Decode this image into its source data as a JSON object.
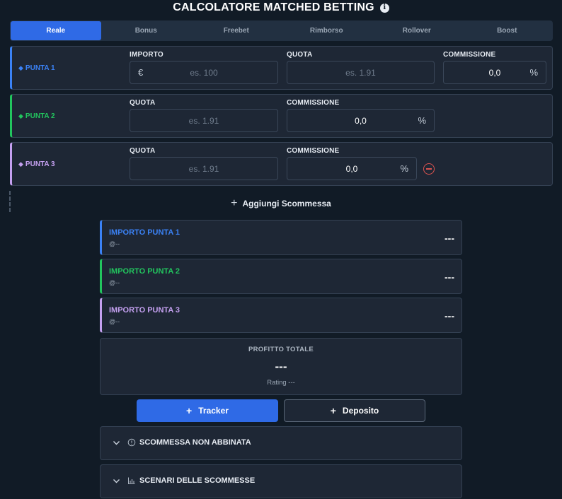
{
  "header": {
    "title": "CALCOLATORE MATCHED BETTING",
    "info_icon": "info-icon"
  },
  "tabs": [
    {
      "label": "Reale",
      "active": true
    },
    {
      "label": "Bonus",
      "active": false
    },
    {
      "label": "Freebet",
      "active": false
    },
    {
      "label": "Rimborso",
      "active": false
    },
    {
      "label": "Rollover",
      "active": false
    },
    {
      "label": "Boost",
      "active": false
    }
  ],
  "bets": [
    {
      "name": "PUNTA 1",
      "color": "#3b82f6",
      "importo_label": "IMPORTO",
      "importo_currency": "€",
      "importo_placeholder": "es. 100",
      "quota_label": "QUOTA",
      "quota_placeholder": "es. 1.91",
      "commissione_label": "COMMISSIONE",
      "commissione_value": "0,0",
      "commissione_unit": "%"
    },
    {
      "name": "PUNTA 2",
      "color": "#22c55e",
      "quota_label": "QUOTA",
      "quota_placeholder": "es. 1.91",
      "commissione_label": "COMMISSIONE",
      "commissione_value": "0,0",
      "commissione_unit": "%"
    },
    {
      "name": "PUNTA 3",
      "color": "#c4a0f0",
      "quota_label": "QUOTA",
      "quota_placeholder": "es. 1.91",
      "commissione_label": "COMMISSIONE",
      "commissione_value": "0,0",
      "commissione_unit": "%"
    }
  ],
  "add_bet": {
    "icon": "plus-icon",
    "label": "Aggiungi Scommessa"
  },
  "stakes": [
    {
      "title": "IMPORTO PUNTA 1",
      "odds": "@--",
      "value": "---",
      "color": "#3b82f6"
    },
    {
      "title": "IMPORTO PUNTA 2",
      "odds": "@--",
      "value": "---",
      "color": "#22c55e"
    },
    {
      "title": "IMPORTO PUNTA 3",
      "odds": "@--",
      "value": "---",
      "color": "#c4a0f0"
    }
  ],
  "profit": {
    "label": "PROFITTO TOTALE",
    "value": "---",
    "rating": "Rating ---"
  },
  "buttons": {
    "tracker_label": "Tracker",
    "deposit_label": "Deposito",
    "plus": "+"
  },
  "accordions": [
    {
      "label": "SCOMMESSA NON ABBINATA",
      "icon": "alert-circle-icon"
    },
    {
      "label": "SCENARI DELLE SCOMMESSE",
      "icon": "bar-chart-icon"
    }
  ]
}
